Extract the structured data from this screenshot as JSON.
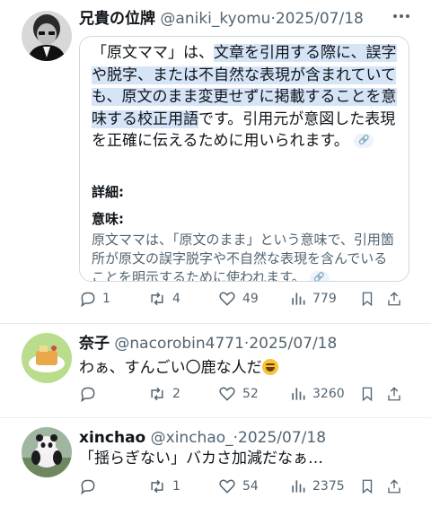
{
  "posts": [
    {
      "name": "兄貴の位牌",
      "handle": "@aniki_kyomu",
      "separator": "·",
      "date": "2025/07/18",
      "card": {
        "text_pre": "「原文ママ」は、",
        "text_highlight": "文章を引用する際に、誤字や脱字、または不自然な表現が含まれていても、原文のまま変更せずに掲載することを意味する校正用語",
        "text_post": "です。引用元が意図した表現を正確に伝えるために用いられます。",
        "details_label": "詳細:",
        "meaning_label": "意味:",
        "meaning_text": "原文ママは、「原文のまま」という意味で、引用箇所が原文の誤字脱字や不自然な表現を含んでいることを明示するために使われます。"
      },
      "stats": {
        "replies": "1",
        "reposts": "4",
        "likes": "49",
        "views": "779"
      }
    },
    {
      "name": "奈子",
      "handle": "@nacorobin4771",
      "separator": "·",
      "date": "2025/07/18",
      "text": "わぁ、すんごい〇鹿な人だ",
      "stats": {
        "replies": "",
        "reposts": "2",
        "likes": "52",
        "views": "3260"
      }
    },
    {
      "name": "xinchao",
      "handle": "@xinchao_",
      "separator": "·",
      "date": "2025/07/18",
      "text": "「揺らぎない」バカさ加減だなぁ…",
      "stats": {
        "replies": "",
        "reposts": "1",
        "likes": "54",
        "views": "2375"
      }
    }
  ],
  "icons": [
    "reply-icon",
    "repost-icon",
    "like-icon",
    "views-icon",
    "bookmark-icon",
    "share-icon",
    "more-icon",
    "link-icon",
    "laughing-emoji-icon"
  ],
  "colors": {
    "highlight": "#d6e4f8",
    "muted": "#536471",
    "border": "#cfd9de",
    "emoji": "#f7c531"
  }
}
